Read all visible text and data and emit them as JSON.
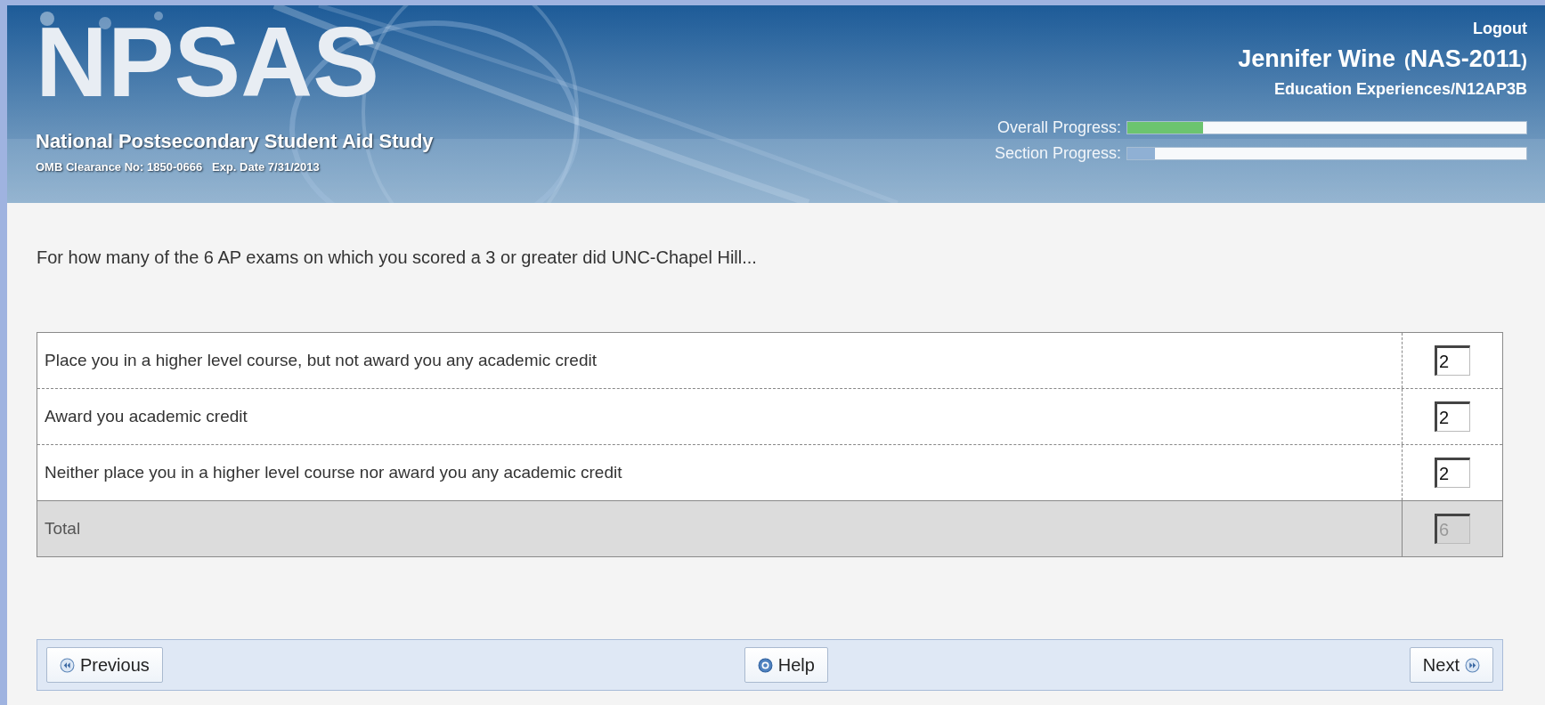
{
  "header": {
    "logo": "NPSAS",
    "study_name": "National Postsecondary Student Aid Study",
    "clearance": "OMB Clearance No: 1850-0666   Exp. Date 7/31/2013",
    "logout": "Logout",
    "user_name": "Jennifer Wine",
    "user_id_open": "(",
    "user_id": "NAS-2011",
    "user_id_close": ")",
    "section_path": "Education Experiences/N12AP3B",
    "progress": [
      {
        "label": "Overall Progress:",
        "level": 0.19,
        "color": "#6cc46f"
      },
      {
        "label": "Section Progress:",
        "level": 0.07,
        "color": "#8fb0d4"
      }
    ]
  },
  "question": "For how many of the 6 AP exams on which you scored a 3 or greater did UNC-Chapel Hill...",
  "table": {
    "rows": [
      {
        "label": "Place you in a higher level course, but not award you any academic credit",
        "value": "2",
        "kind": "entry"
      },
      {
        "label": "Award you academic credit",
        "value": "2",
        "kind": "entry"
      },
      {
        "label": "Neither place you in a higher level course nor award you any academic credit",
        "value": "2",
        "kind": "entry"
      },
      {
        "label": "Total",
        "value": "6",
        "kind": "total"
      }
    ]
  },
  "footer": {
    "buttons": [
      {
        "label": "Previous",
        "kind": "previous"
      },
      {
        "label": "Help",
        "kind": "help"
      },
      {
        "label": "Next",
        "kind": "next"
      }
    ]
  }
}
